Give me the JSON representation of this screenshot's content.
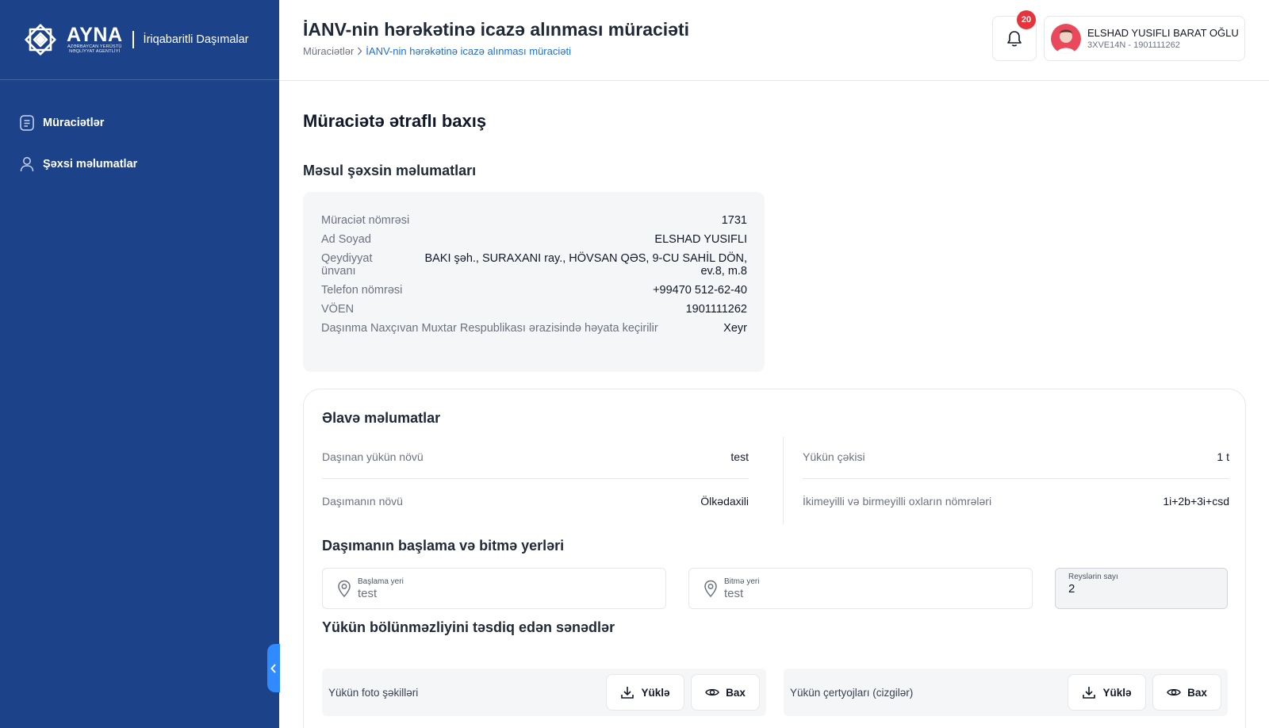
{
  "sidebar": {
    "logo_word": "AYNA",
    "logo_sub_1": "AZƏRBAYCAN YERÜSTÜ",
    "logo_sub_2": "NƏQLİYYAT AGENTLİYİ",
    "app_name": "İriqabaritli Daşımalar",
    "items": [
      {
        "label": "Müraciətlər",
        "icon": "document-list-icon"
      },
      {
        "label": "Şəxsi məlumatlar",
        "icon": "user-icon"
      }
    ]
  },
  "header": {
    "title": "İANV-nin hərəkətinə icazə alınması müraciəti",
    "breadcrumb_root": "Müraciətlər",
    "breadcrumb_current": "İANV-nin hərəkətinə icazə alınması müraciəti",
    "notification_count": "20",
    "user_name": "ELSHAD YUSIFLI BARAT OĞLU",
    "user_sub": "3XVE14N - 1901111262"
  },
  "main": {
    "section_title": "Müraciətə ətraflı baxış",
    "responsible_title": "Məsul şəxsin məlumatları",
    "responsible": [
      {
        "label": "Müraciət nömrəsi",
        "value": "1731"
      },
      {
        "label": "Ad Soyad",
        "value": "ELSHAD YUSIFLI"
      },
      {
        "label": "Qeydiyyat ünvanı",
        "value": "BAKI şəh., SURAXANI ray., HÖVSAN QƏS, 9-CU SAHİL DÖN, ev.8, m.8"
      },
      {
        "label": "Telefon nömrəsi",
        "value": "+99470 512-62-40"
      },
      {
        "label": "VÖEN",
        "value": "1901111262"
      },
      {
        "label": "Daşınma Naxçıvan Muxtar Respublikası ərazisində həyata keçirilir",
        "value": "Xeyr"
      }
    ],
    "extra_title": "Əlavə məlumatlar",
    "extra": {
      "cargo_type_label": "Daşınan yükün növü",
      "cargo_type_value": "test",
      "transport_type_label": "Daşımanın növü",
      "transport_type_value": "Ölkədaxili",
      "weight_label": "Yükün çəkisi",
      "weight_value": "1 t",
      "axles_label": "İkimeyilli və birmeyilli oxların nömrələri",
      "axles_value": "1i+2b+3i+csd"
    },
    "route_title": "Daşımanın başlama və bitmə yerləri",
    "start_label": "Başlama yeri",
    "start_value": "test",
    "end_label": "Bitmə yeri",
    "end_value": "test",
    "trips_label": "Reyslərin sayı",
    "trips_value": "2",
    "docs_title": "Yükün bölünməzliyini təsdiq edən sənədlər",
    "docs": [
      {
        "label": "Yükün foto şəkilləri",
        "upload": "Yüklə",
        "view": "Bax"
      },
      {
        "label": "Yükün çertyojları (cizgilər)",
        "upload": "Yüklə",
        "view": "Bax"
      }
    ]
  },
  "colors": {
    "sidebar_bg": "#1c4289",
    "accent": "#1d6fd8",
    "badge": "#e5343b",
    "collapse_tab": "#2f8bff"
  }
}
